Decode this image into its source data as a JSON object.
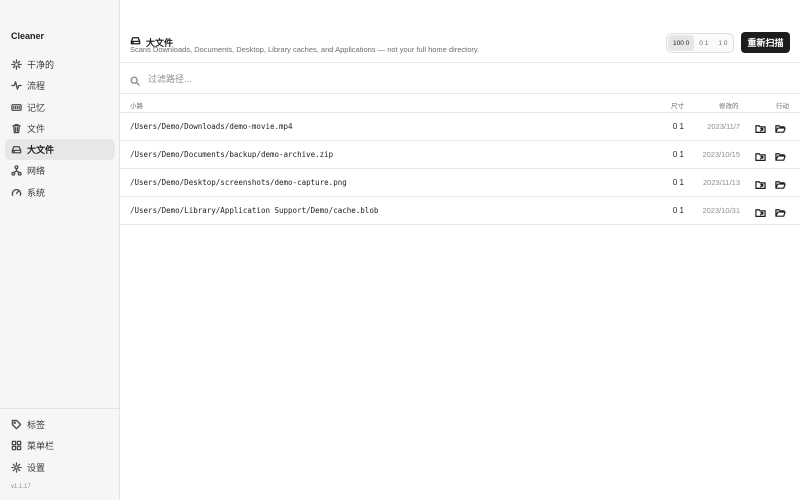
{
  "app": {
    "name": "Cleaner",
    "version": "v1.1.17"
  },
  "sidebar": {
    "items": [
      {
        "label": "干净的",
        "icon": "sparkle-icon"
      },
      {
        "label": "流程",
        "icon": "activity-icon"
      },
      {
        "label": "记忆",
        "icon": "memory-icon"
      },
      {
        "label": "文件",
        "icon": "trash-icon"
      },
      {
        "label": "大文件",
        "icon": "drive-icon",
        "active": true
      },
      {
        "label": "网络",
        "icon": "network-icon"
      },
      {
        "label": "系统",
        "icon": "gauge-icon"
      }
    ],
    "bottom_items": [
      {
        "label": "标签",
        "icon": "tag-icon"
      },
      {
        "label": "菜单栏",
        "icon": "grid-icon"
      },
      {
        "label": "设置",
        "icon": "gear-icon"
      }
    ]
  },
  "header": {
    "title": "大文件",
    "subtitle": "Scans Downloads, Documents, Desktop, Library caches, and Applications — not your full home directory.",
    "segments": [
      {
        "label": "100 0",
        "active": true
      },
      {
        "label": "0 1",
        "active": false
      },
      {
        "label": "1 0",
        "active": false
      }
    ],
    "rescan_label": "重新扫描"
  },
  "filter": {
    "placeholder": "过滤路径...",
    "value": ""
  },
  "table": {
    "columns": {
      "path": "小路",
      "size": "尺寸",
      "modified": "修改的",
      "actions": "行动"
    },
    "rows": [
      {
        "path": "/Users/Demo/Downloads/demo-movie.mp4",
        "size": "0 1",
        "modified": "2023/11/7"
      },
      {
        "path": "/Users/Demo/Documents/backup/demo-archive.zip",
        "size": "0 1",
        "modified": "2023/10/15"
      },
      {
        "path": "/Users/Demo/Desktop/screenshots/demo-capture.png",
        "size": "0 1",
        "modified": "2023/11/13"
      },
      {
        "path": "/Users/Demo/Library/Application Support/Demo/cache.blob",
        "size": "0 1",
        "modified": "2023/10/31"
      }
    ]
  }
}
